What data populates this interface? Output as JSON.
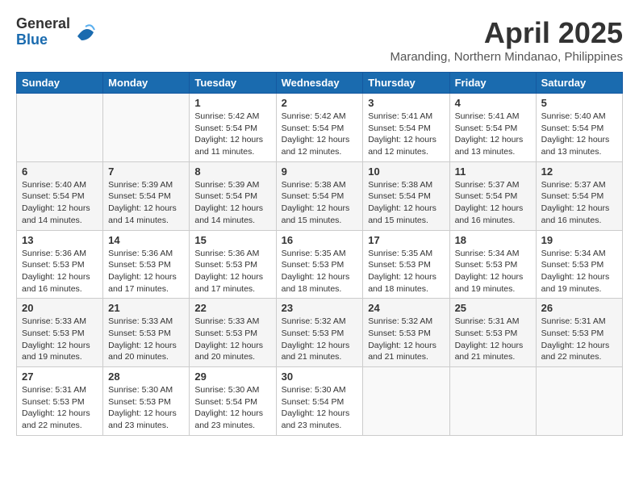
{
  "logo": {
    "general": "General",
    "blue": "Blue"
  },
  "title": "April 2025",
  "location": "Maranding, Northern Mindanao, Philippines",
  "days_of_week": [
    "Sunday",
    "Monday",
    "Tuesday",
    "Wednesday",
    "Thursday",
    "Friday",
    "Saturday"
  ],
  "weeks": [
    [
      {
        "day": "",
        "info": ""
      },
      {
        "day": "",
        "info": ""
      },
      {
        "day": "1",
        "info": "Sunrise: 5:42 AM\nSunset: 5:54 PM\nDaylight: 12 hours and 11 minutes."
      },
      {
        "day": "2",
        "info": "Sunrise: 5:42 AM\nSunset: 5:54 PM\nDaylight: 12 hours and 12 minutes."
      },
      {
        "day": "3",
        "info": "Sunrise: 5:41 AM\nSunset: 5:54 PM\nDaylight: 12 hours and 12 minutes."
      },
      {
        "day": "4",
        "info": "Sunrise: 5:41 AM\nSunset: 5:54 PM\nDaylight: 12 hours and 13 minutes."
      },
      {
        "day": "5",
        "info": "Sunrise: 5:40 AM\nSunset: 5:54 PM\nDaylight: 12 hours and 13 minutes."
      }
    ],
    [
      {
        "day": "6",
        "info": "Sunrise: 5:40 AM\nSunset: 5:54 PM\nDaylight: 12 hours and 14 minutes."
      },
      {
        "day": "7",
        "info": "Sunrise: 5:39 AM\nSunset: 5:54 PM\nDaylight: 12 hours and 14 minutes."
      },
      {
        "day": "8",
        "info": "Sunrise: 5:39 AM\nSunset: 5:54 PM\nDaylight: 12 hours and 14 minutes."
      },
      {
        "day": "9",
        "info": "Sunrise: 5:38 AM\nSunset: 5:54 PM\nDaylight: 12 hours and 15 minutes."
      },
      {
        "day": "10",
        "info": "Sunrise: 5:38 AM\nSunset: 5:54 PM\nDaylight: 12 hours and 15 minutes."
      },
      {
        "day": "11",
        "info": "Sunrise: 5:37 AM\nSunset: 5:54 PM\nDaylight: 12 hours and 16 minutes."
      },
      {
        "day": "12",
        "info": "Sunrise: 5:37 AM\nSunset: 5:54 PM\nDaylight: 12 hours and 16 minutes."
      }
    ],
    [
      {
        "day": "13",
        "info": "Sunrise: 5:36 AM\nSunset: 5:53 PM\nDaylight: 12 hours and 16 minutes."
      },
      {
        "day": "14",
        "info": "Sunrise: 5:36 AM\nSunset: 5:53 PM\nDaylight: 12 hours and 17 minutes."
      },
      {
        "day": "15",
        "info": "Sunrise: 5:36 AM\nSunset: 5:53 PM\nDaylight: 12 hours and 17 minutes."
      },
      {
        "day": "16",
        "info": "Sunrise: 5:35 AM\nSunset: 5:53 PM\nDaylight: 12 hours and 18 minutes."
      },
      {
        "day": "17",
        "info": "Sunrise: 5:35 AM\nSunset: 5:53 PM\nDaylight: 12 hours and 18 minutes."
      },
      {
        "day": "18",
        "info": "Sunrise: 5:34 AM\nSunset: 5:53 PM\nDaylight: 12 hours and 19 minutes."
      },
      {
        "day": "19",
        "info": "Sunrise: 5:34 AM\nSunset: 5:53 PM\nDaylight: 12 hours and 19 minutes."
      }
    ],
    [
      {
        "day": "20",
        "info": "Sunrise: 5:33 AM\nSunset: 5:53 PM\nDaylight: 12 hours and 19 minutes."
      },
      {
        "day": "21",
        "info": "Sunrise: 5:33 AM\nSunset: 5:53 PM\nDaylight: 12 hours and 20 minutes."
      },
      {
        "day": "22",
        "info": "Sunrise: 5:33 AM\nSunset: 5:53 PM\nDaylight: 12 hours and 20 minutes."
      },
      {
        "day": "23",
        "info": "Sunrise: 5:32 AM\nSunset: 5:53 PM\nDaylight: 12 hours and 21 minutes."
      },
      {
        "day": "24",
        "info": "Sunrise: 5:32 AM\nSunset: 5:53 PM\nDaylight: 12 hours and 21 minutes."
      },
      {
        "day": "25",
        "info": "Sunrise: 5:31 AM\nSunset: 5:53 PM\nDaylight: 12 hours and 21 minutes."
      },
      {
        "day": "26",
        "info": "Sunrise: 5:31 AM\nSunset: 5:53 PM\nDaylight: 12 hours and 22 minutes."
      }
    ],
    [
      {
        "day": "27",
        "info": "Sunrise: 5:31 AM\nSunset: 5:53 PM\nDaylight: 12 hours and 22 minutes."
      },
      {
        "day": "28",
        "info": "Sunrise: 5:30 AM\nSunset: 5:53 PM\nDaylight: 12 hours and 23 minutes."
      },
      {
        "day": "29",
        "info": "Sunrise: 5:30 AM\nSunset: 5:54 PM\nDaylight: 12 hours and 23 minutes."
      },
      {
        "day": "30",
        "info": "Sunrise: 5:30 AM\nSunset: 5:54 PM\nDaylight: 12 hours and 23 minutes."
      },
      {
        "day": "",
        "info": ""
      },
      {
        "day": "",
        "info": ""
      },
      {
        "day": "",
        "info": ""
      }
    ]
  ]
}
